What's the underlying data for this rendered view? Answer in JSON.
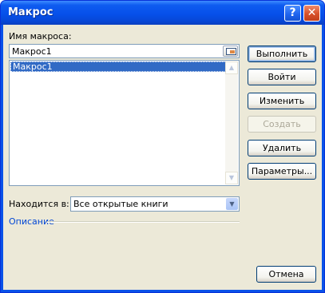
{
  "window": {
    "title": "Макрос",
    "help_label": "?",
    "close_label": "✕"
  },
  "macro_name": {
    "label": "Имя макроса:",
    "value": "Макрос1",
    "ref_icon": "range-select-icon"
  },
  "macro_list": {
    "items": [
      "Макрос1"
    ],
    "selected_index": 0
  },
  "buttons": {
    "run": "Выполнить",
    "step_into": "Войти",
    "edit": "Изменить",
    "create": "Создать",
    "delete": "Удалить",
    "options": "Параметры..."
  },
  "location": {
    "label": "Находится в:",
    "selected": "Все открытые книги"
  },
  "description": {
    "label": "Описание"
  },
  "cancel": "Отмена",
  "colors": {
    "title_bar": "#0a52e8",
    "selection": "#316ac5",
    "group_label": "#0046d5"
  }
}
